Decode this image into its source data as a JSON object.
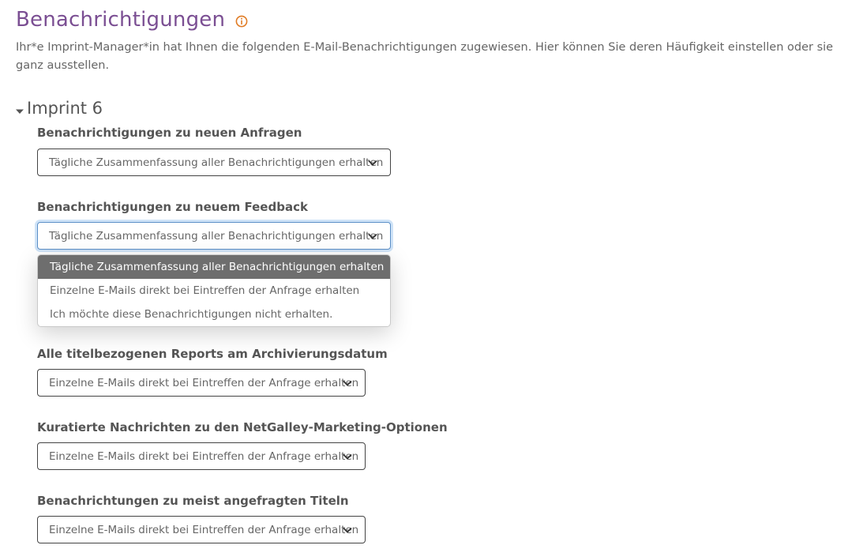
{
  "header": {
    "title": "Benachrichtigungen",
    "info_icon": "info-icon",
    "intro": "Ihr*e Imprint-Manager*in hat Ihnen die folgenden E-Mail-Benachrichtigungen zugewiesen. Hier können Sie deren Häufigkeit einstellen oder sie ganz ausstellen."
  },
  "colors": {
    "title": "#7b4f93",
    "info_icon": "#e07b24",
    "focus_ring": "#cfe3f7",
    "selected_option_bg": "#6e6e6e"
  },
  "section": {
    "title": "Imprint 6",
    "expanded": true,
    "toggle_icon": "caret-down-icon"
  },
  "settings": [
    {
      "label": "Benachrichtigungen zu neuen Anfragen",
      "value": "Tägliche Zusammenfassung aller Benachrichtigungen erhalten"
    },
    {
      "label": "Benachrichtigungen zu neuem Feedback",
      "value": "Tägliche Zusammenfassung aller Benachrichtigungen erhalten",
      "open": true
    },
    {
      "label": "Alle titelbezogenen Reports am Archivierungsdatum",
      "value": "Einzelne E-Mails direkt bei Eintreffen der Anfrage erhalten"
    },
    {
      "label": "Kuratierte Nachrichten zu den NetGalley-Marketing-Optionen",
      "value": "Einzelne E-Mails direkt bei Eintreffen der Anfrage erhalten"
    },
    {
      "label": "Benachrichtungen zu meist angefragten Titeln",
      "value": "Einzelne E-Mails direkt bei Eintreffen der Anfrage erhalten"
    }
  ],
  "dropdown": {
    "options": [
      "Tägliche Zusammenfassung aller Benachrichtigungen erhalten",
      "Einzelne E-Mails direkt bei Eintreffen der Anfrage erhalten",
      "Ich möchte diese Benachrichtigungen nicht erhalten."
    ],
    "selected_index": 0
  }
}
